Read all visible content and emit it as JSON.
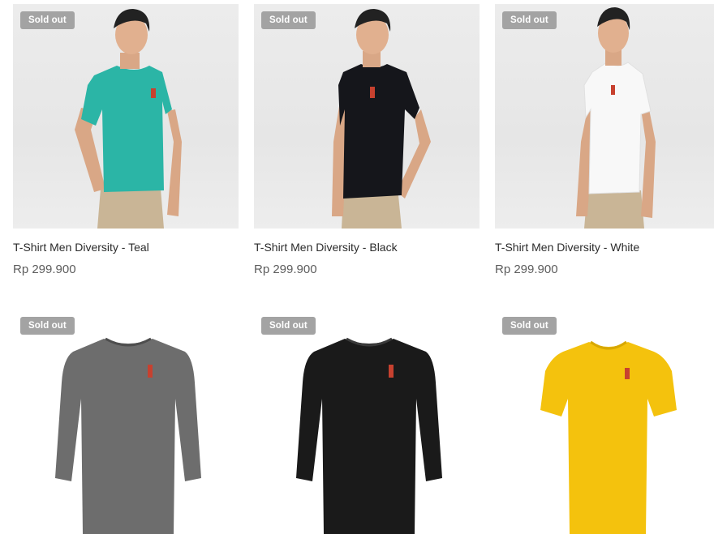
{
  "products": [
    {
      "badge": "Sold out",
      "name": "T-Shirt Men Diversity - Teal",
      "price": "Rp 299.900",
      "color": "#2bb5a6",
      "style": "model-tee"
    },
    {
      "badge": "Sold out",
      "name": "T-Shirt Men Diversity - Black",
      "price": "Rp 299.900",
      "color": "#15161b",
      "style": "model-tee"
    },
    {
      "badge": "Sold out",
      "name": "T-Shirt Men Diversity - White",
      "price": "Rp 299.900",
      "color": "#f8f8f8",
      "style": "model-tee"
    },
    {
      "badge": "Sold out",
      "color": "#6d6d6d",
      "style": "longsleeve"
    },
    {
      "badge": "Sold out",
      "color": "#1a1a1a",
      "style": "longsleeve"
    },
    {
      "badge": "Sold out",
      "color": "#f4c20d",
      "style": "tee"
    }
  ]
}
